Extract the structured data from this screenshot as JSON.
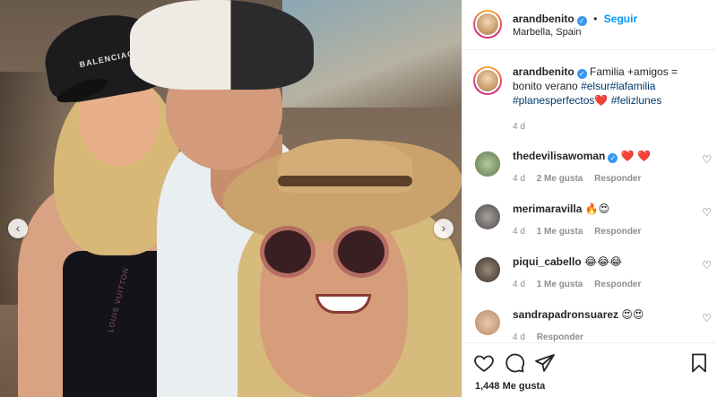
{
  "post": {
    "username": "arandbenito",
    "follow_label": "Seguir",
    "location": "Marbella, Spain",
    "caption_intro": "Familia +amigos = bonito verano",
    "hashtags": [
      "#elsur",
      "#lafamilia",
      "#planesperfectos",
      "#felizlunes"
    ],
    "caption_emoji": "❤️",
    "time": "4 d",
    "likes": "1,448 Me gusta"
  },
  "comments": [
    {
      "username": "thedevilisawoman",
      "text": "❤️ ❤️",
      "verified": true,
      "time": "4 d",
      "likes": "2 Me gusta",
      "reply": "Responder"
    },
    {
      "username": "merimaravilla",
      "text": "🔥😍",
      "verified": false,
      "time": "4 d",
      "likes": "1 Me gusta",
      "reply": "Responder"
    },
    {
      "username": "piqui_cabello",
      "text": "😂😂😂",
      "verified": false,
      "time": "4 d",
      "likes": "1 Me gusta",
      "reply": "Responder"
    },
    {
      "username": "sandrapadronsuarez",
      "text": "😍😍",
      "verified": false,
      "time": "4 d",
      "likes": "",
      "reply": "Responder"
    }
  ],
  "photo_text": {
    "cap_brand": "BALENCIAGA",
    "strap_brand": "LOUIS VUITTON"
  },
  "icons": {
    "like": "heart-icon",
    "comment": "comment-icon",
    "share": "share-icon",
    "save": "bookmark-icon",
    "prev": "chevron-left-icon",
    "next": "chevron-right-icon"
  },
  "colors": {
    "accent": "#0095f6",
    "hashtag": "#00376b",
    "muted": "#8e8e8e",
    "heart": "#ed4956"
  }
}
